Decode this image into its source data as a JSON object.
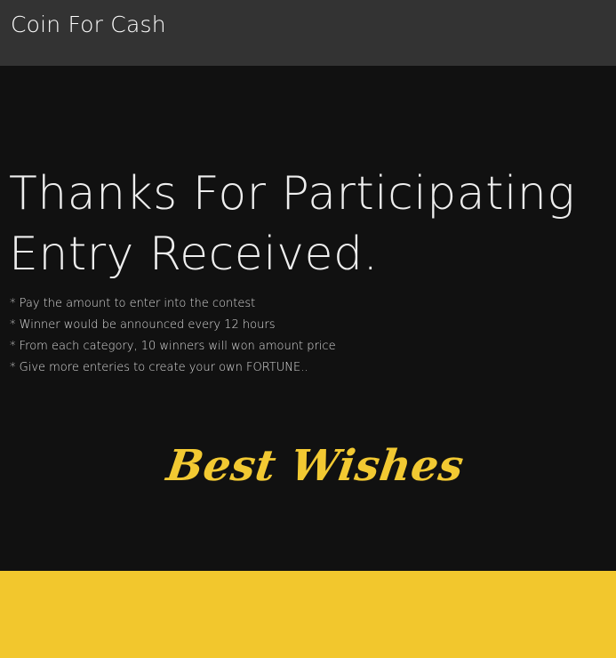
{
  "navbar": {
    "brand": "Coin For Cash"
  },
  "main": {
    "headline_line1": "Thanks For Participating",
    "headline_line2": "Entry Received.",
    "notes": [
      "* Pay the amount to enter into the contest",
      "* Winner would be announced every 12 hours",
      "* From each category, 10 winners will won amount price",
      "* Give more enteries to create your own FORTUNE.."
    ],
    "signature": "Best Wishes"
  },
  "colors": {
    "navbar_bg": "#333333",
    "page_bg": "#111111",
    "accent_yellow": "#f2c72d"
  }
}
